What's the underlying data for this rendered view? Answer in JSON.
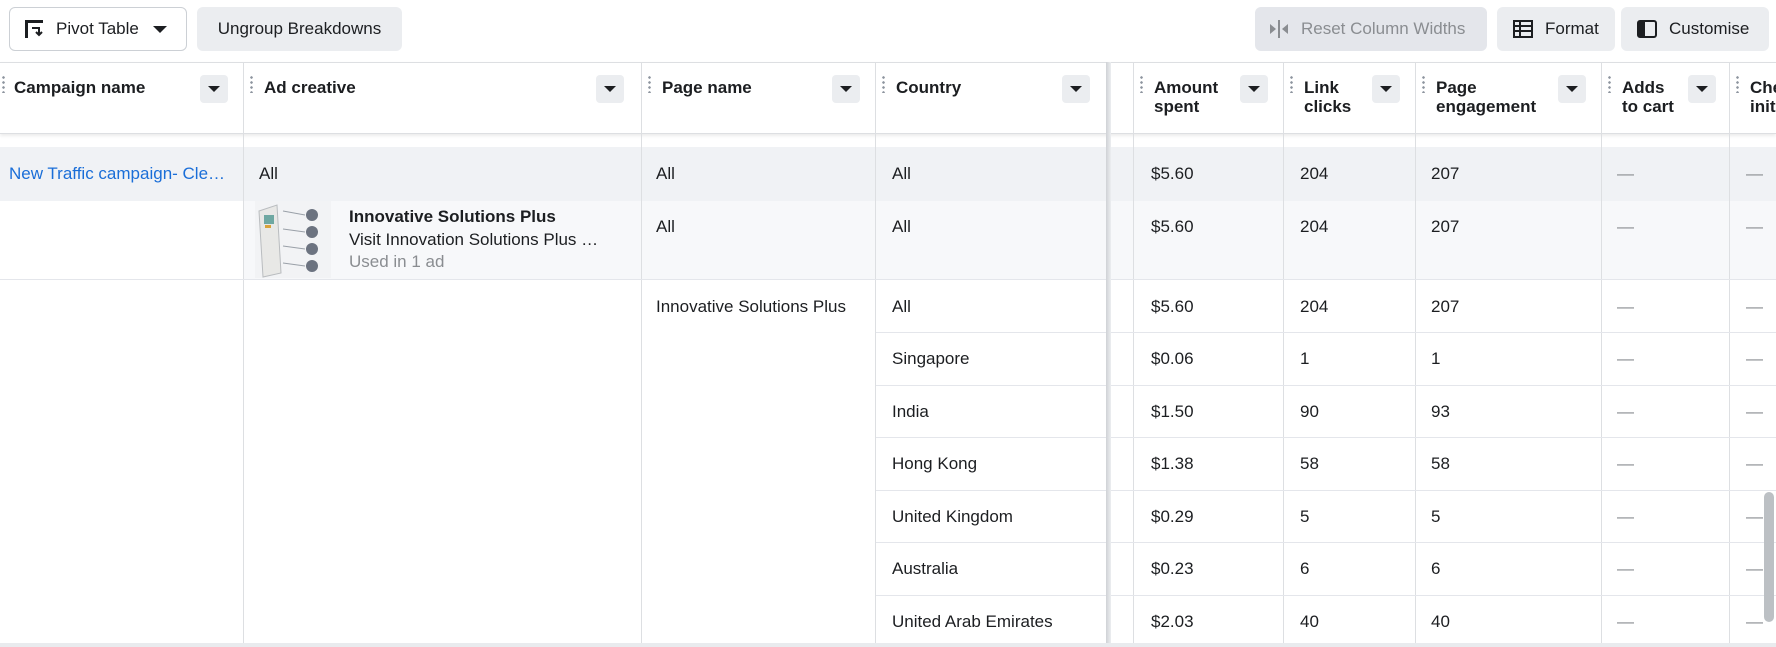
{
  "toolbar": {
    "pivot_label": "Pivot Table",
    "ungroup_label": "Ungroup Breakdowns",
    "reset_label": "Reset Column Widths",
    "format_label": "Format",
    "customise_label": "Customise"
  },
  "columns": {
    "campaign": "Campaign name",
    "ad_creative": "Ad creative",
    "page_name": "Page name",
    "country": "Country",
    "amount_spent_1": "Amount",
    "amount_spent_2": "spent",
    "link_clicks_1": "Link",
    "link_clicks_2": "clicks",
    "page_engagement_1": "Page",
    "page_engagement_2": "engagement",
    "adds_to_cart_1": "Adds",
    "adds_to_cart_2": "to cart",
    "checkouts_1": "Che",
    "checkouts_2": "init"
  },
  "rows": {
    "campaign": {
      "name": "New Traffic campaign- Cle…",
      "ad": "All",
      "page": "All",
      "country": "All",
      "amount": "$5.60",
      "clicks": "204",
      "engagement": "207",
      "adds": "—",
      "checkouts": "—"
    },
    "creative": {
      "title": "Innovative Solutions Plus",
      "subtitle": "Visit Innovation Solutions Plus …",
      "meta": "Used in 1 ad",
      "page": "All",
      "country": "All",
      "amount": "$5.60",
      "clicks": "204",
      "engagement": "207",
      "adds": "—",
      "checkouts": "—"
    },
    "page_name": "Innovative Solutions Plus",
    "countries": [
      {
        "country": "All",
        "amount": "$5.60",
        "clicks": "204",
        "engagement": "207",
        "adds": "—",
        "checkouts": "—"
      },
      {
        "country": "Singapore",
        "amount": "$0.06",
        "clicks": "1",
        "engagement": "1",
        "adds": "—",
        "checkouts": "—"
      },
      {
        "country": "India",
        "amount": "$1.50",
        "clicks": "90",
        "engagement": "93",
        "adds": "—",
        "checkouts": "—"
      },
      {
        "country": "Hong Kong",
        "amount": "$1.38",
        "clicks": "58",
        "engagement": "58",
        "adds": "—",
        "checkouts": "—"
      },
      {
        "country": "United Kingdom",
        "amount": "$0.29",
        "clicks": "5",
        "engagement": "5",
        "adds": "—",
        "checkouts": "—"
      },
      {
        "country": "Australia",
        "amount": "$0.23",
        "clicks": "6",
        "engagement": "6",
        "adds": "—",
        "checkouts": "—"
      },
      {
        "country": "United Arab Emirates",
        "amount": "$2.03",
        "clicks": "40",
        "engagement": "40",
        "adds": "—",
        "checkouts": "—"
      }
    ]
  },
  "colors": {
    "link_blue": "#1a6ed8",
    "border": "#dddfe2",
    "button_grey": "#ebedf0"
  }
}
